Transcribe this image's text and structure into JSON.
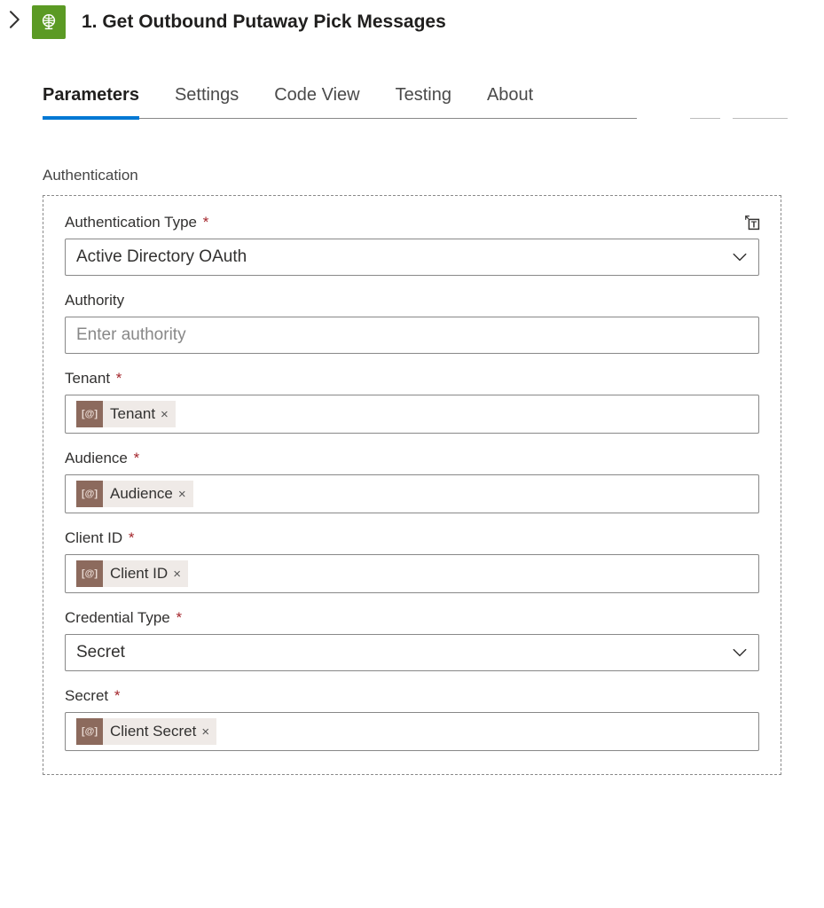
{
  "header": {
    "title": "1. Get Outbound Putaway Pick Messages"
  },
  "tabs": {
    "items": [
      {
        "label": "Parameters"
      },
      {
        "label": "Settings"
      },
      {
        "label": "Code View"
      },
      {
        "label": "Testing"
      },
      {
        "label": "About"
      }
    ]
  },
  "section": {
    "authentication_label": "Authentication"
  },
  "auth": {
    "auth_type_label": "Authentication Type",
    "auth_type_value": "Active Directory OAuth",
    "authority_label": "Authority",
    "authority_placeholder": "Enter authority",
    "tenant_label": "Tenant",
    "tenant_token": "Tenant",
    "audience_label": "Audience",
    "audience_token": "Audience",
    "client_id_label": "Client ID",
    "client_id_token": "Client ID",
    "credential_type_label": "Credential Type",
    "credential_type_value": "Secret",
    "secret_label": "Secret",
    "secret_token": "Client Secret"
  },
  "glyphs": {
    "token_icon": "[@]",
    "token_close": "×"
  }
}
